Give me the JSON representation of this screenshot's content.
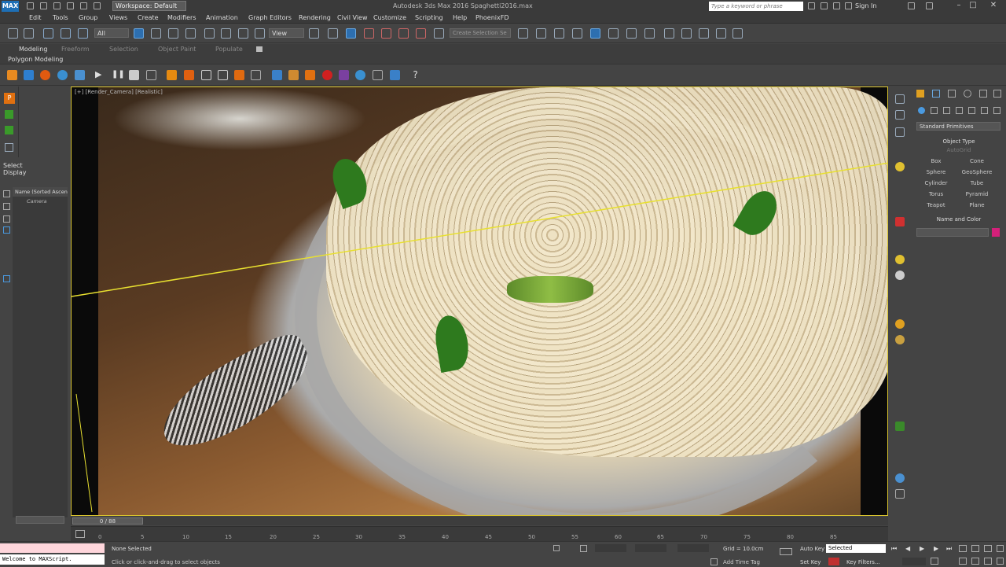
{
  "titlebar": {
    "workspace": "Workspace: Default",
    "title": "Autodesk 3ds Max 2016    Spaghetti2016.max",
    "search_placeholder": "Type a keyword or phrase",
    "sign_in": "Sign In"
  },
  "menu": [
    "Edit",
    "Tools",
    "Group",
    "Views",
    "Create",
    "Modifiers",
    "Animation",
    "Graph Editors",
    "Rendering",
    "Civil View",
    "Customize",
    "Scripting",
    "Help",
    "PhoenixFD"
  ],
  "toolbar": {
    "selection_filter": "All",
    "reference_coord": "View",
    "named_selection": "Create Selection Se"
  },
  "ribbon": {
    "tabs": [
      "Modeling",
      "Freeform",
      "Selection",
      "Object Paint",
      "Populate"
    ],
    "sub_label": "Polygon Modeling"
  },
  "scene_explorer": {
    "tabs": [
      "Select",
      "Display"
    ],
    "header": "Name (Sorted Ascen",
    "items": [
      "Camera"
    ]
  },
  "viewport": {
    "label": "[+] [Render_Camera] [Realistic]"
  },
  "command_panel": {
    "category": "Standard Primitives",
    "object_type_title": "Object Type",
    "autogrid": "AutoGrid",
    "primitives": [
      "Box",
      "Cone",
      "Sphere",
      "GeoSphere",
      "Cylinder",
      "Tube",
      "Torus",
      "Pyramid",
      "Teapot",
      "Plane"
    ],
    "name_color_title": "Name and Color",
    "swatch_color": "#d4207a"
  },
  "timeline": {
    "position": "0 / 88",
    "ticks": [
      "0",
      "5",
      "10",
      "15",
      "20",
      "25",
      "30",
      "35",
      "40",
      "45",
      "50",
      "55",
      "60",
      "65",
      "70",
      "75",
      "80",
      "85"
    ]
  },
  "status": {
    "maxscript": "Welcome to MAXScript.",
    "selection": "None Selected",
    "prompt": "Click or click-and-drag to select objects",
    "grid": "Grid = 10.0cm",
    "add_time_tag": "Add Time Tag",
    "auto_key": "Auto Key",
    "set_key": "Set Key",
    "key_mode": "Selected",
    "key_filters": "Key Filters..."
  }
}
